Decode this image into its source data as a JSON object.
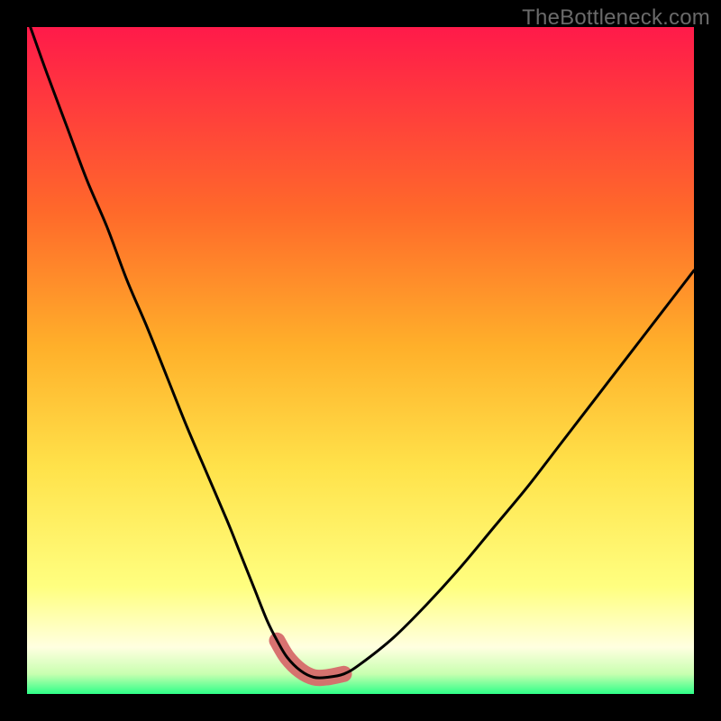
{
  "watermark": "TheBottleneck.com",
  "colors": {
    "background": "#000000",
    "gradient_top": "#ff1a4a",
    "gradient_mid1": "#ff7f1a",
    "gradient_mid2": "#ffd633",
    "gradient_mid3": "#ffff66",
    "gradient_mid4": "#ffffcc",
    "gradient_bottom": "#2eff88",
    "curve": "#000000",
    "highlight": "#d66a6a"
  },
  "chart_data": {
    "type": "line",
    "title": "",
    "xlabel": "",
    "ylabel": "",
    "xlim": [
      0,
      100
    ],
    "ylim": [
      0,
      100
    ],
    "grid": false,
    "curve": {
      "name": "bottleneck-curve",
      "x": [
        0.5,
        3,
        6,
        9,
        12,
        15,
        18,
        21,
        24,
        27,
        30,
        32,
        34,
        36,
        37.5,
        39,
        41,
        43,
        45,
        47.5,
        50,
        55,
        60,
        65,
        70,
        75,
        80,
        85,
        90,
        95,
        100
      ],
      "y": [
        100,
        93,
        85,
        77,
        70,
        62,
        55,
        47.5,
        40,
        33,
        26,
        21,
        16,
        11,
        8,
        5.5,
        3.5,
        2.5,
        2.5,
        3.0,
        4.5,
        8.5,
        13.5,
        19,
        25,
        31,
        37.5,
        44,
        50.5,
        57,
        63.5
      ]
    },
    "highlight_range": {
      "x_start": 36,
      "x_end": 48,
      "y_max": 9
    }
  }
}
